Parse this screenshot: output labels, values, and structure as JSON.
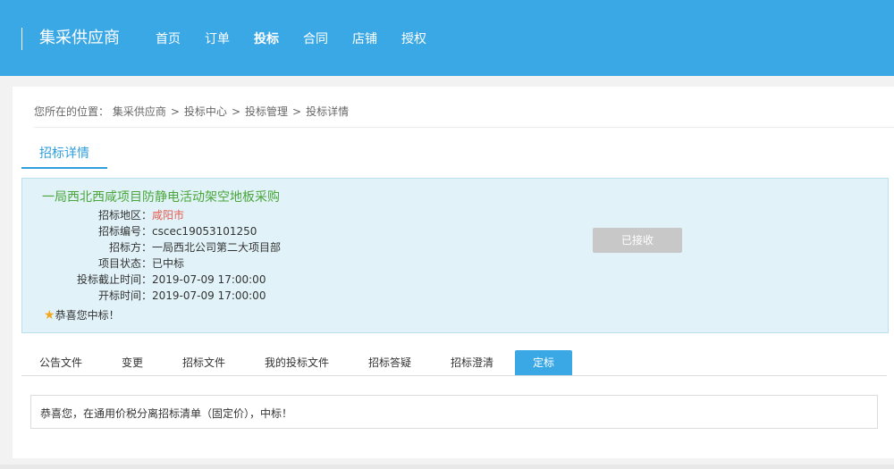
{
  "header": {
    "brand": "集采供应商",
    "nav": [
      "首页",
      "订单",
      "投标",
      "合同",
      "店铺",
      "授权"
    ]
  },
  "breadcrumb": {
    "prefix": "您所在的位置：",
    "items": [
      "集采供应商",
      "投标中心",
      "投标管理",
      "投标详情"
    ]
  },
  "section_tab": "招标详情",
  "tender": {
    "title": "一局西北西咸项目防静电活动架空地板采购",
    "fields": [
      {
        "label": "招标地区：",
        "value": "咸阳市"
      },
      {
        "label": "招标编号：",
        "value": "cscec19053101250"
      },
      {
        "label": "招标方：",
        "value": "一局西北公司第二大项目部"
      },
      {
        "label": "项目状态：",
        "value": "已中标"
      },
      {
        "label": "投标截止时间：",
        "value": "2019-07-09 17:00:00"
      },
      {
        "label": "开标时间：",
        "value": "2019-07-09 17:00:00"
      }
    ],
    "congrats": "恭喜您中标！",
    "button": "已接收"
  },
  "tabs": [
    "公告文件",
    "变更",
    "招标文件",
    "我的投标文件",
    "招标答疑",
    "招标澄清",
    "定标"
  ],
  "result_text": "恭喜您，在通用价税分离招标清单（固定价），中标！",
  "colors": {
    "header": "#3ba8e6",
    "accent": "#2e9fdb",
    "title_green": "#4aa63a",
    "region_red": "#e85b50",
    "info_bg": "#e1f3f9"
  }
}
